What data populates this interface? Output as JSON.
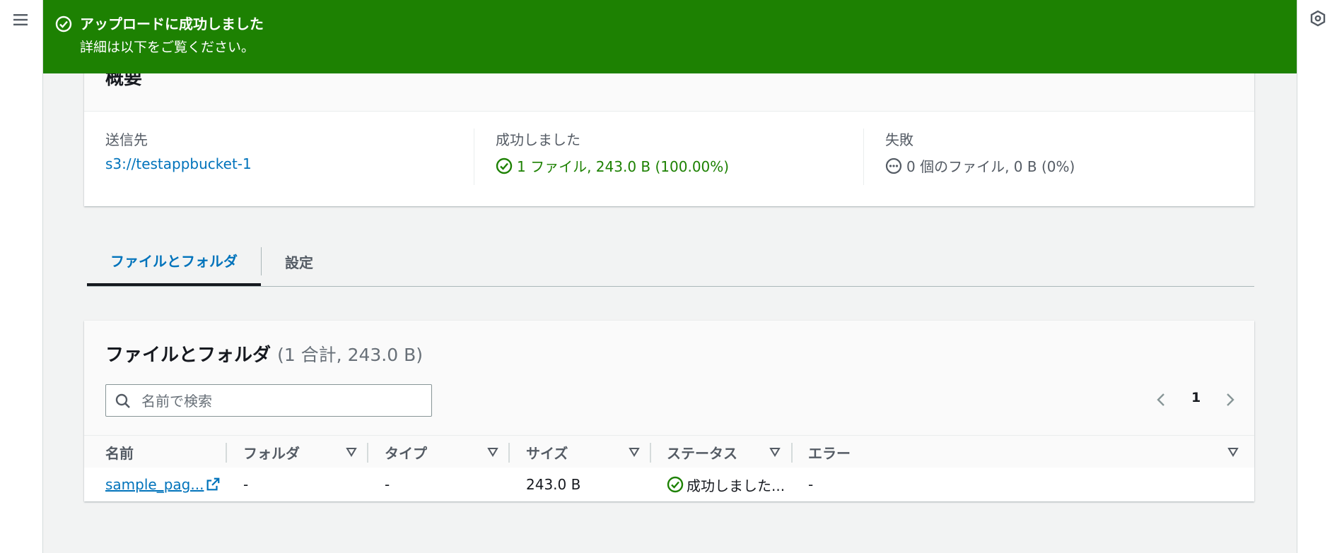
{
  "colors": {
    "success": "#1d8102",
    "link": "#0073bb",
    "text": "#16191f",
    "muted": "#545b64",
    "page_bg": "#f2f3f3"
  },
  "icons": {
    "left_nav": "hamburger-menu-icon",
    "right_rail": "hexagon-gear-icon",
    "flash": "success-check-circle-icon",
    "success": "check-circle-icon",
    "failed": "ellipsis-circle-icon",
    "search": "search-icon",
    "external": "external-link-icon",
    "sort": "sort-triangle-icon",
    "prev": "chevron-left-icon",
    "next": "chevron-right-icon"
  },
  "flash": {
    "title": "アップロードに成功しました",
    "message": "詳細は以下をご覧ください。"
  },
  "summary": {
    "title": "概要",
    "destination_label": "送信先",
    "destination_value": "s3://testappbucket-1",
    "succeeded_label": "成功しました",
    "succeeded_value": "1 ファイル, 243.0 B (100.00%)",
    "failed_label": "失敗",
    "failed_value": "0 個のファイル, 0 B (0%)"
  },
  "tabs": [
    {
      "label": "ファイルとフォルダ",
      "active": true
    },
    {
      "label": "設定",
      "active": false
    }
  ],
  "files": {
    "title": "ファイルとフォルダ",
    "count": "(1 合計, 243.0 B)",
    "search_placeholder": "名前で検索",
    "page": "1",
    "columns": [
      "名前",
      "フォルダ",
      "タイプ",
      "サイズ",
      "ステータス",
      "エラー"
    ],
    "rows": [
      {
        "name": "sample_pag...",
        "folder": "-",
        "type": "-",
        "size": "243.0 B",
        "status": "成功しました...",
        "error": "-"
      }
    ]
  }
}
